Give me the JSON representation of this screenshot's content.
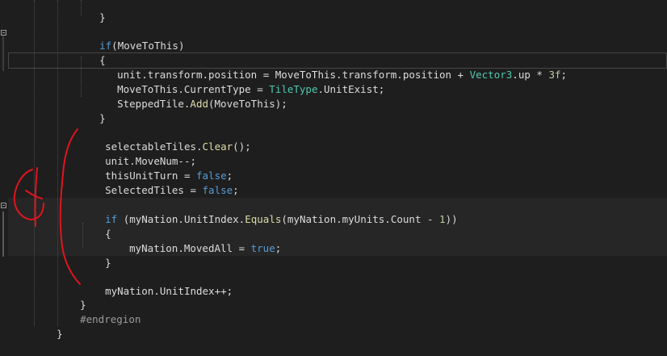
{
  "editor": {
    "lines": [
      {
        "id": "l0",
        "text": "}"
      },
      {
        "id": "l1",
        "k": "if",
        "a": "(",
        "b": "MoveToThis",
        ")": ")"
      },
      {
        "id": "l2",
        "text": "{"
      },
      {
        "id": "l3"
      },
      {
        "id": "l4"
      },
      {
        "id": "l5"
      },
      {
        "id": "l6",
        "text": "}"
      }
    ],
    "code": {
      "close_top": "}",
      "if1_kw": "if",
      "if1_cond": "(MoveToThis)",
      "open1": "{",
      "l_unit": "unit",
      "l_transform": ".transform.position = MoveToThis.transform.position + ",
      "l_vector3": "Vector3",
      "l_up": ".up * ",
      "l_3f": "3f",
      "l_semi": ";",
      "l_mtt": "MoveToThis.CurrentType = ",
      "l_tiletype": "TileType",
      "l_unitexist": ".UnitExist;",
      "l_stepped": "SteppedTile.",
      "l_add": "Add",
      "l_add_args": "(MoveToThis);",
      "close1": "}",
      "sel_a": "selectableTiles.",
      "sel_clear": "Clear",
      "sel_b": "();",
      "movenum": "unit.MoveNum--;",
      "turn_a": "thisUnitTurn = ",
      "false1": "false",
      "semi": ";",
      "selected_a": "SelectedTiles = ",
      "false2": "false",
      "if2_kw": "if",
      "if2_a": " (myNation.UnitIndex.",
      "if2_equals": "Equals",
      "if2_b": "(myNation.myUnits.Count - ",
      "if2_one": "1",
      "if2_c": "))",
      "open2": "{",
      "moved_a": "myNation.MovedAll = ",
      "true1": "true",
      "close2": "}",
      "unitindex": "myNation.UnitIndex++;",
      "close3": "}",
      "endregion": "#endregion",
      "close4": "}"
    }
  },
  "colors": {
    "background": "#1e1e1e",
    "keyword": "#569cd6",
    "type": "#4ec9b0",
    "method": "#dcdcaa",
    "number": "#b5cea8",
    "annotation_ink": "#e0141e"
  },
  "annotation": {
    "icon": "red-handwritten-bracket-and-mark"
  }
}
